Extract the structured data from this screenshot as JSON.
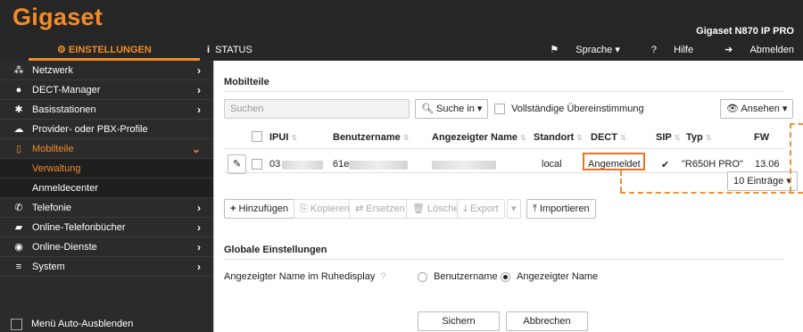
{
  "header": {
    "logo": "Gigaset",
    "model": "Gigaset N870 IP PRO",
    "nav_settings": "EINSTELLUNGEN",
    "nav_status": "STATUS",
    "language": "Sprache",
    "help": "Hilfe",
    "logout": "Abmelden"
  },
  "sidebar": {
    "items": [
      {
        "label": "Netzwerk"
      },
      {
        "label": "DECT-Manager"
      },
      {
        "label": "Basisstationen"
      },
      {
        "label": "Provider- oder PBX-Profile"
      },
      {
        "label": "Mobilteile"
      },
      {
        "label": "Telefonie"
      },
      {
        "label": "Online-Telefonbücher"
      },
      {
        "label": "Online-Dienste"
      },
      {
        "label": "System"
      }
    ],
    "sub_items": [
      "Verwaltung",
      "Anmeldecenter"
    ],
    "autohide": "Menü Auto-Ausblenden"
  },
  "mobilteile": {
    "title": "Mobilteile",
    "search_placeholder": "Suchen",
    "search_in": "Suche in",
    "exact_match": "Vollständige Übereinstimmung",
    "view": "Ansehen",
    "columns": [
      "IPUI",
      "Benutzername",
      "Angezeigter Name",
      "Standort",
      "DECT",
      "SIP",
      "Typ",
      "FW"
    ],
    "row": {
      "ipui": "03",
      "username": "61e",
      "standort": "local",
      "dect": "Angemeldet",
      "sip": "✔",
      "typ": "\"R650H PRO\"",
      "fw": "13.06"
    },
    "entries": "10 Einträge",
    "actions": {
      "add": "Hinzufügen",
      "copy": "Kopieren",
      "replace": "Ersetzen",
      "delete": "Löschen",
      "export": "Export",
      "import": "Importieren"
    }
  },
  "global": {
    "title": "Globale Einstellungen",
    "label": "Angezeigter Name im Ruhedisplay",
    "opt_user": "Benutzername",
    "opt_display": "Angezeigter Name",
    "save": "Sichern",
    "cancel": "Abbrechen"
  },
  "colors": {
    "accent": "#f28c28",
    "highlight": "#f07020",
    "header_bg": "#262626",
    "sidebar_bg": "#2b2b2b"
  }
}
